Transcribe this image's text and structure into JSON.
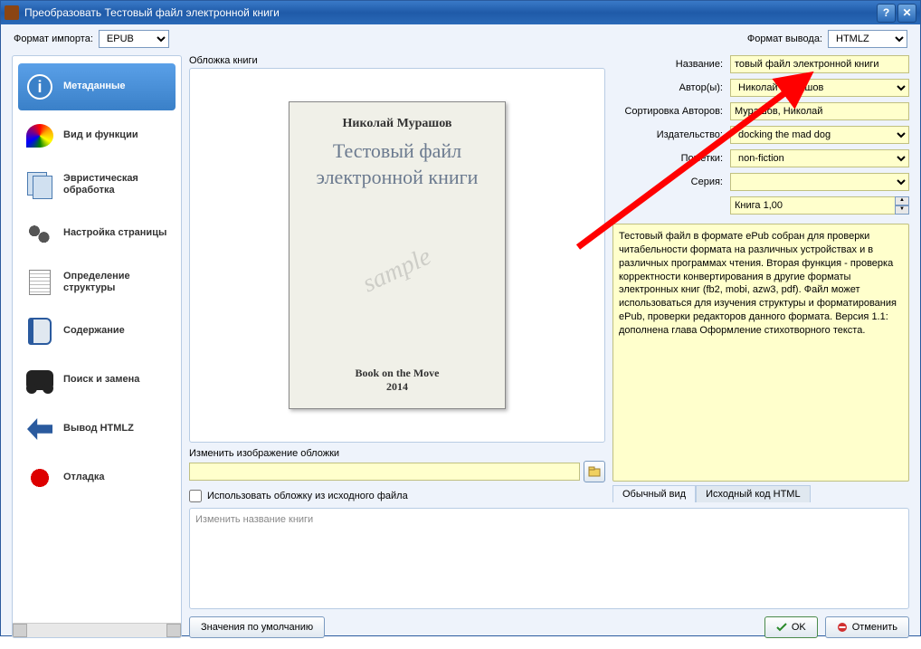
{
  "window": {
    "title": "Преобразовать Тестовый файл электронной книги"
  },
  "import": {
    "label": "Формат импорта:",
    "value": "EPUB"
  },
  "output": {
    "label": "Формат вывода:",
    "value": "HTMLZ"
  },
  "sidebar": {
    "items": [
      {
        "label": "Метаданные"
      },
      {
        "label": "Вид и функции"
      },
      {
        "label": "Эвристическая обработка"
      },
      {
        "label": "Настройка страницы"
      },
      {
        "label": "Определение структуры"
      },
      {
        "label": "Содержание"
      },
      {
        "label": "Поиск и замена"
      },
      {
        "label": "Вывод HTMLZ"
      },
      {
        "label": "Отладка"
      }
    ]
  },
  "cover": {
    "group_label": "Обложка книги",
    "author": "Николай Мурашов",
    "title": "Тестовый файл электронной книги",
    "sample": "sample",
    "footer_line1": "Book on the Move",
    "footer_line2": "2014",
    "change_label": "Изменить изображение обложки",
    "use_source_label": "Использовать обложку из исходного файла",
    "path_value": ""
  },
  "meta": {
    "name_label": "Название:",
    "name_value": "товый файл электронной книги",
    "authors_label": "Автор(ы):",
    "authors_value": "Николай Мурашов",
    "authorsort_label": "Сортировка Авторов:",
    "authorsort_value": "Мурашов, Николай",
    "publisher_label": "Издательство:",
    "publisher_value": "docking the mad dog",
    "tags_label": "Пометки:",
    "tags_value": "non-fiction",
    "series_label": "Серия:",
    "series_value": "",
    "book_num": "Книга 1,00",
    "description": "Тестовый файл в формате ePub собран для проверки читабельности формата на различных устройствах и в различных программах чтения. Вторая функция - проверка корректности конвертирования в другие форматы электронных книг (fb2, mobi, azw3, pdf). Файл может использоваться для изучения структуры и форматирования ePub, проверки редакторов данного формата. Версия 1.1: дополнена глава Оформление стихотворного текста."
  },
  "tabs": {
    "normal": "Обычный вид",
    "source": "Исходный код HTML"
  },
  "title_edit": {
    "placeholder": "Изменить название книги"
  },
  "buttons": {
    "defaults": "Значения по умолчанию",
    "ok": "OK",
    "cancel": "Отменить"
  }
}
